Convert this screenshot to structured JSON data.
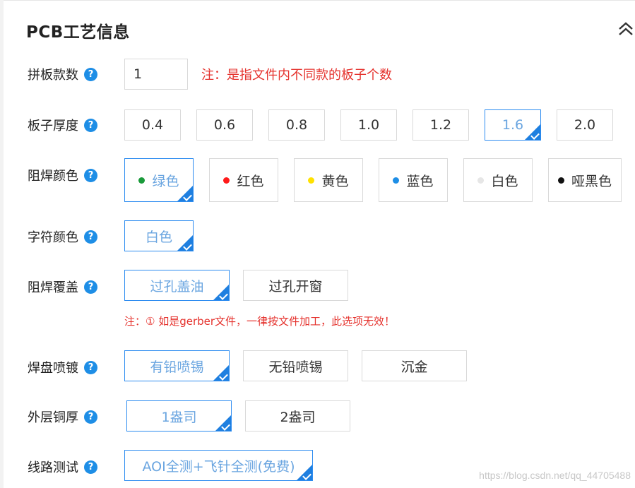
{
  "section": {
    "title": "PCB工艺信息",
    "collapse_icon": "double-chevron-up-icon"
  },
  "rows": {
    "panel_count": {
      "label": "拼板款数",
      "value": "1",
      "note": "注：是指文件内不同款的板子个数"
    },
    "thickness": {
      "label": "板子厚度",
      "options": [
        "0.4",
        "0.6",
        "0.8",
        "1.0",
        "1.2",
        "1.6",
        "2.0"
      ],
      "selected": "1.6"
    },
    "solder_mask_color": {
      "label": "阻焊颜色",
      "options": [
        "绿色",
        "红色",
        "黄色",
        "蓝色",
        "白色",
        "哑黑色"
      ],
      "dot_colors": [
        "#1a9a3a",
        "#ff1a1a",
        "#ffe100",
        "#1e8ee6",
        "#e6e6e6",
        "#111111"
      ],
      "selected": "绿色"
    },
    "silkscreen_color": {
      "label": "字符颜色",
      "options": [
        "白色"
      ],
      "selected": "白色"
    },
    "solder_mask_cover": {
      "label": "阻焊覆盖",
      "options": [
        "过孔盖油",
        "过孔开窗"
      ],
      "selected": "过孔盖油",
      "note": "注：① 如是gerber文件，一律按文件加工，此选项无效！"
    },
    "surface_finish": {
      "label": "焊盘喷镀",
      "options": [
        "有铅喷锡",
        "无铅喷锡",
        "沉金"
      ],
      "selected": "有铅喷锡"
    },
    "copper_thickness": {
      "label": "外层铜厚",
      "options": [
        "1盎司",
        "2盎司"
      ],
      "selected": "1盎司"
    },
    "circuit_test": {
      "label": "线路测试",
      "options": [
        "AOI全测+飞针全测(免费)"
      ],
      "selected": "AOI全测+飞针全测(免费)"
    }
  },
  "help_glyph": "?",
  "watermark": "https://blog.csdn.net/qq_44705488",
  "colors": {
    "accent": "#1e8ee6",
    "selected_border": "#2d8cf0",
    "selected_text": "#6aa5e0",
    "note_red": "#e5322d"
  }
}
